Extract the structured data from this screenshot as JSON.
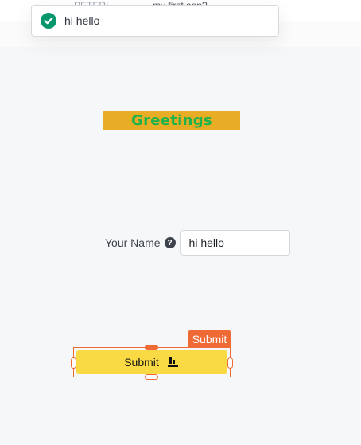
{
  "header": {
    "breadcrumb_left": "PETER!",
    "app_title": "my first app?"
  },
  "toast": {
    "message": "hi hello",
    "icon": "check-circle-icon"
  },
  "canvas": {
    "greeting_text": "Greetings",
    "name_label": "Your Name",
    "name_value": "hi hello",
    "help_icon": "question-circle-icon",
    "widget_tag": "Submit",
    "submit_label": "Submit",
    "submit_icon": "user-upload-icon"
  },
  "colors": {
    "background": "#f6f7f9",
    "toast_check": "#07976c",
    "greeting_bg": "#e8ad24",
    "greeting_text": "#20b24a",
    "button_bg": "#f9da45",
    "selection_accent": "#ef6a35"
  }
}
